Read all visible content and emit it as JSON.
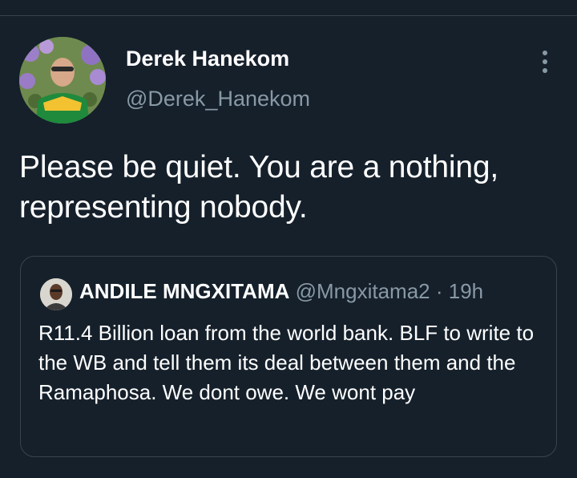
{
  "tweet": {
    "author": {
      "display_name": "Derek Hanekom",
      "handle": "@Derek_Hanekom",
      "avatar_icon": "profile-photo-icon"
    },
    "text": "Please be quiet. You are a nothing, representing nobody."
  },
  "quoted_tweet": {
    "author": {
      "display_name": "ANDILE MNGXITAMA",
      "handle": "@Mngxitama2",
      "separator": " · ",
      "time": "19h",
      "avatar_icon": "profile-photo-icon"
    },
    "text": "R11.4 Billion loan from the world bank. BLF to write to the WB and tell them its deal between them and the Ramaphosa. We dont owe. We wont pay"
  },
  "colors": {
    "background": "#15202b",
    "secondary_text": "#8899a6",
    "border": "#38444d",
    "primary_text": "#ffffff"
  }
}
